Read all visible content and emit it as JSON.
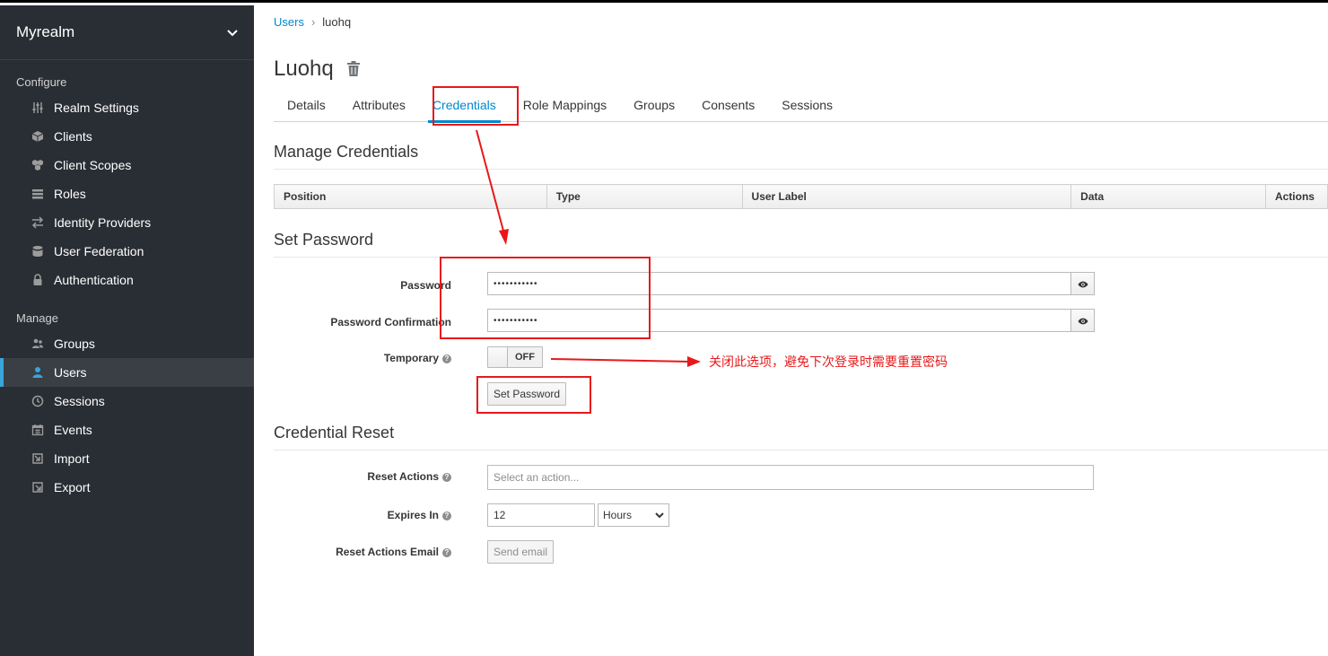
{
  "sidebar": {
    "realm": "Myrealm",
    "configure_label": "Configure",
    "manage_label": "Manage",
    "configure_items": [
      {
        "label": "Realm Settings",
        "icon": "sliders-icon"
      },
      {
        "label": "Clients",
        "icon": "cube-icon"
      },
      {
        "label": "Client Scopes",
        "icon": "cubes-icon"
      },
      {
        "label": "Roles",
        "icon": "list-icon"
      },
      {
        "label": "Identity Providers",
        "icon": "exchange-icon"
      },
      {
        "label": "User Federation",
        "icon": "database-icon"
      },
      {
        "label": "Authentication",
        "icon": "lock-icon"
      }
    ],
    "manage_items": [
      {
        "label": "Groups",
        "icon": "users-icon"
      },
      {
        "label": "Users",
        "icon": "user-icon",
        "active": true
      },
      {
        "label": "Sessions",
        "icon": "clock-icon"
      },
      {
        "label": "Events",
        "icon": "calendar-icon"
      },
      {
        "label": "Import",
        "icon": "import-icon"
      },
      {
        "label": "Export",
        "icon": "export-icon"
      }
    ]
  },
  "breadcrumb": {
    "parent": "Users",
    "current": "luohq"
  },
  "page_title": "Luohq",
  "tabs": [
    "Details",
    "Attributes",
    "Credentials",
    "Role Mappings",
    "Groups",
    "Consents",
    "Sessions"
  ],
  "active_tab": "Credentials",
  "manage_credentials": {
    "title": "Manage Credentials",
    "columns": [
      "Position",
      "Type",
      "User Label",
      "Data",
      "Actions"
    ]
  },
  "set_password": {
    "title": "Set Password",
    "password_label": "Password",
    "password_value": "•••••••••••",
    "confirm_label": "Password Confirmation",
    "confirm_value": "•••••••••••",
    "temporary_label": "Temporary",
    "temporary_state": "OFF",
    "submit_label": "Set Password"
  },
  "credential_reset": {
    "title": "Credential Reset",
    "reset_actions_label": "Reset Actions",
    "reset_actions_placeholder": "Select an action...",
    "expires_label": "Expires In",
    "expires_value": "12",
    "expires_unit": "Hours",
    "email_label": "Reset Actions Email",
    "email_button": "Send email"
  },
  "annotation": {
    "note": "关闭此选项，避免下次登录时需要重置密码",
    "color": "#e8181a"
  },
  "colors": {
    "accent": "#0088ce",
    "sidebar_bg": "#292e34"
  }
}
